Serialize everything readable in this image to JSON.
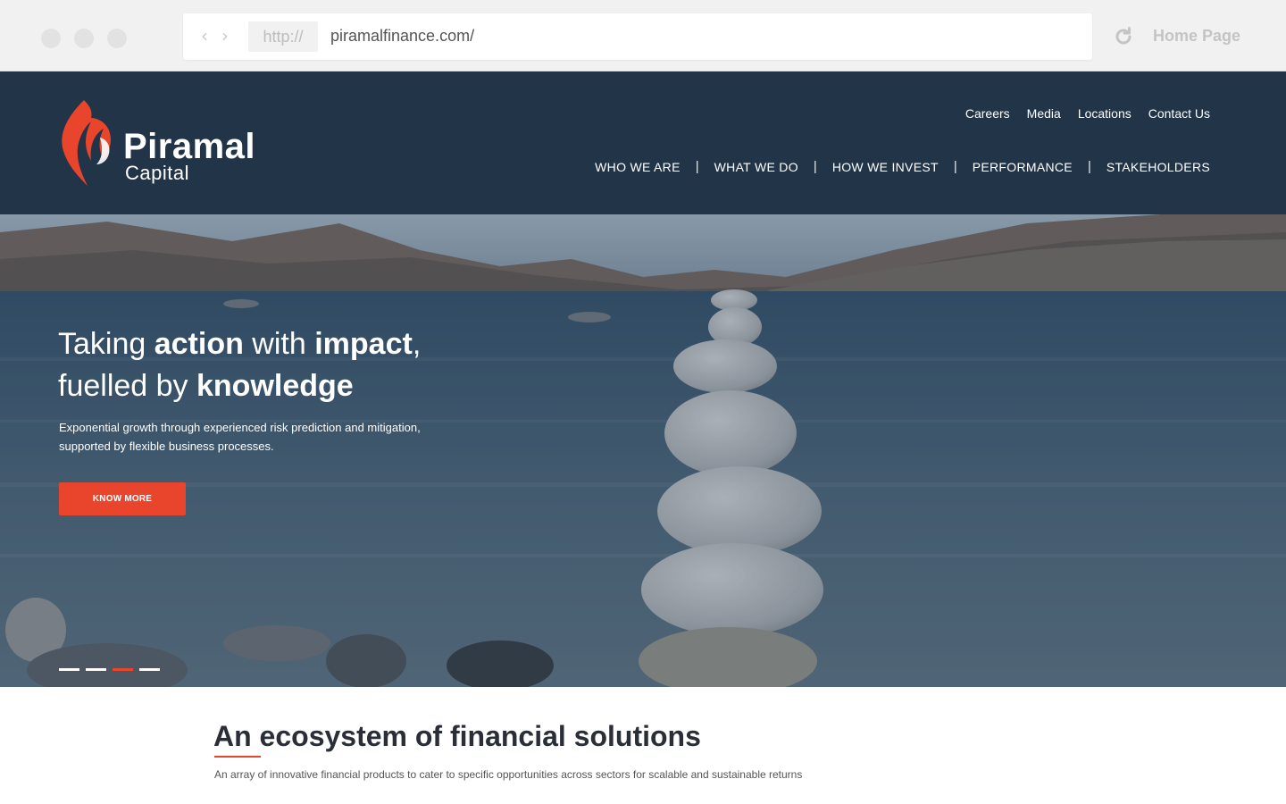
{
  "browser": {
    "protocol": "http://",
    "url": "piramalfinance.com/",
    "home_label": "Home Page"
  },
  "brand": {
    "name": "Piramal",
    "sub": "Capital",
    "accent_color": "#e8452c",
    "header_color": "#223448"
  },
  "util_nav": [
    "Careers",
    "Media",
    "Locations",
    "Contact Us"
  ],
  "main_nav": [
    "WHO WE ARE",
    "WHAT WE DO",
    "HOW WE INVEST",
    "PERFORMANCE",
    "STAKEHOLDERS"
  ],
  "hero": {
    "title_line1": {
      "a": "Taking ",
      "b": "action",
      "c": " with ",
      "d": "impact",
      "e": ","
    },
    "title_line2": {
      "a": "fuelled by ",
      "b": "knowledge"
    },
    "description": "Exponential growth through experienced risk prediction and mitigation, supported by flexible business processes.",
    "cta_label": "KNOW MORE",
    "slides_total": 4,
    "active_slide": 3
  },
  "section": {
    "title": "An ecosystem of financial solutions",
    "description": "An array of innovative financial products to cater to specific opportunities across sectors for scalable and sustainable returns"
  }
}
